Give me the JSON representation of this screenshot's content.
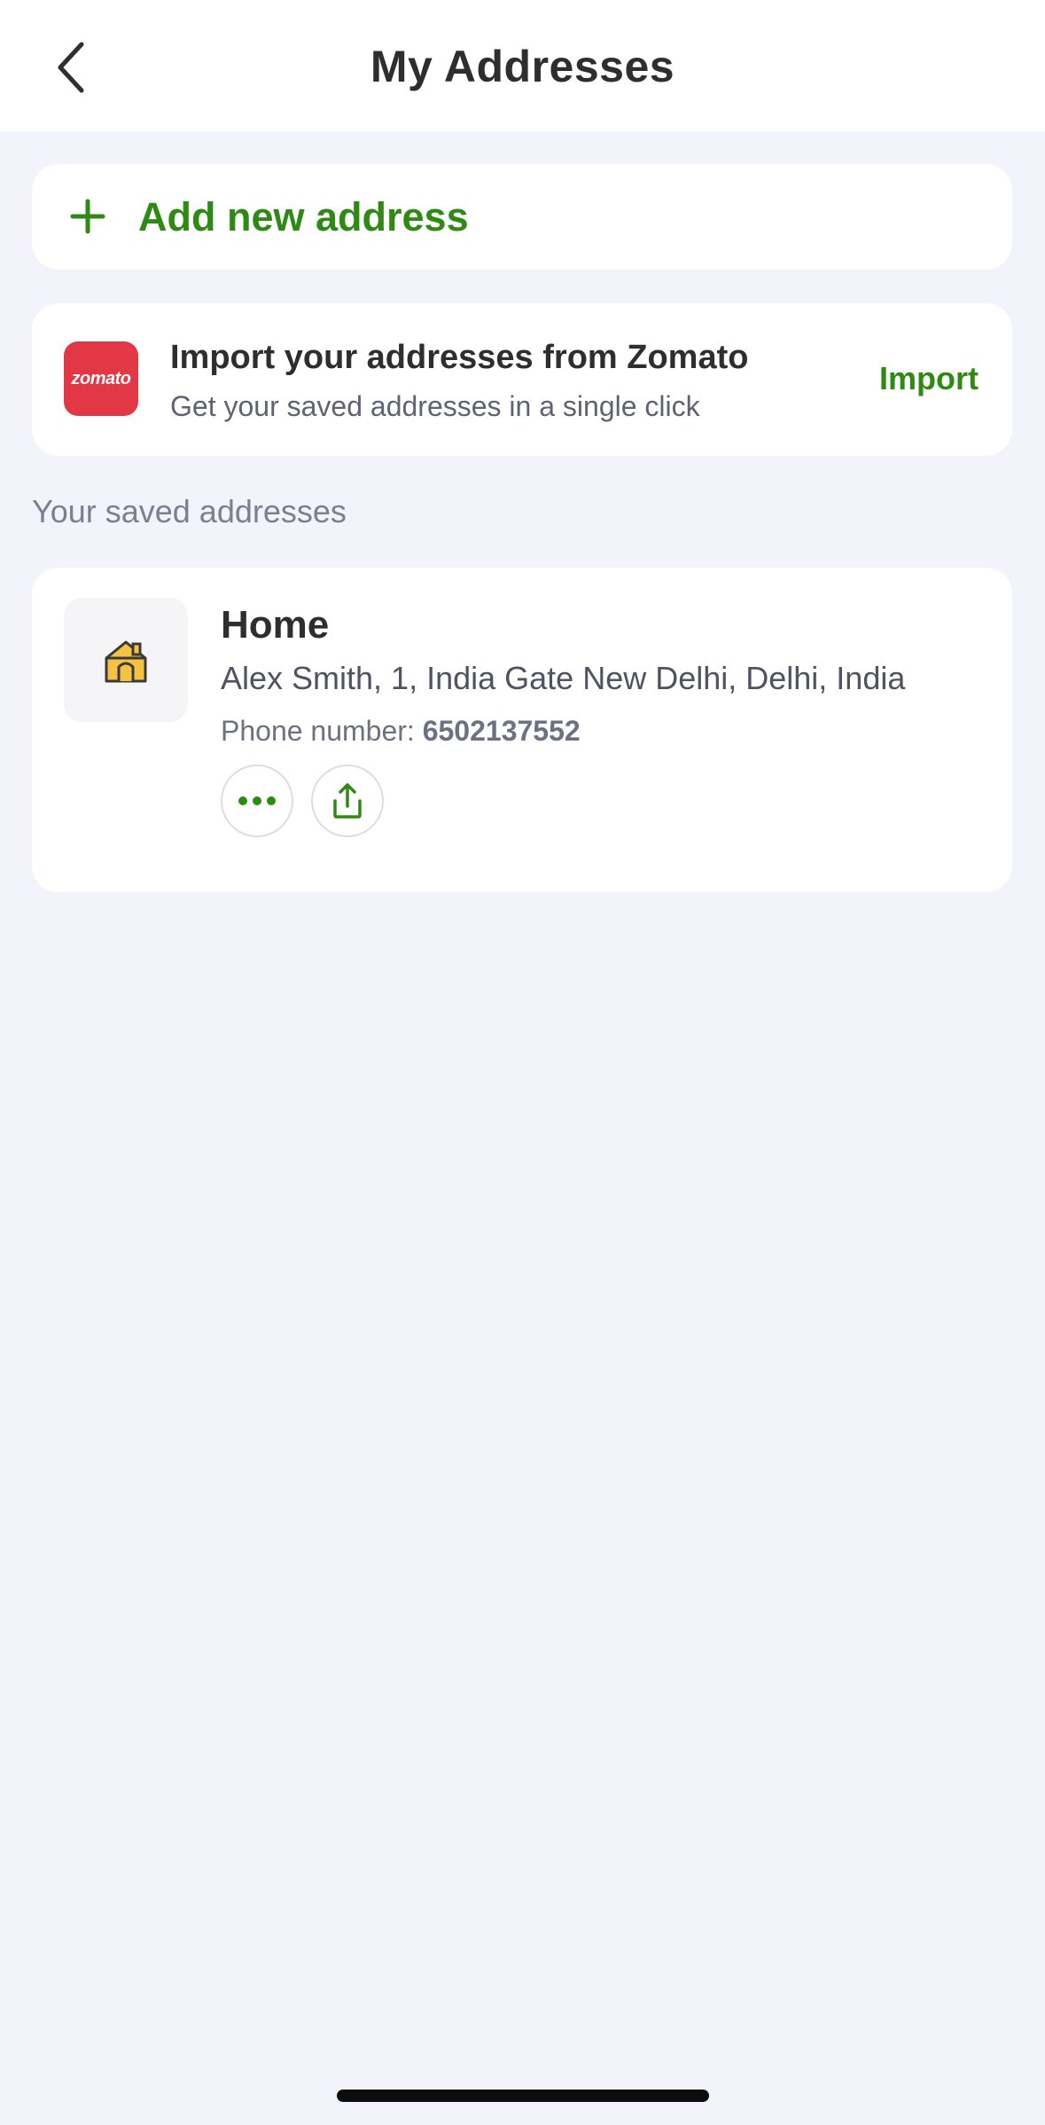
{
  "header": {
    "title": "My Addresses",
    "back_icon": "chevron-left-icon"
  },
  "add_address": {
    "icon": "plus-icon",
    "label": "Add new address"
  },
  "import_card": {
    "logo_text": "zomato",
    "logo_color": "#e23744",
    "title": "Import your addresses from Zomato",
    "subtitle": "Get your saved addresses in a single click",
    "action_label": "Import"
  },
  "saved_section": {
    "title": "Your saved addresses",
    "addresses": [
      {
        "icon": "home-icon",
        "label": "Home",
        "address": "Alex Smith, 1, India Gate New Delhi, Delhi, India",
        "phone_label": "Phone number: ",
        "phone_number": "6502137552",
        "actions": [
          "more-options-icon",
          "share-icon"
        ]
      }
    ]
  },
  "colors": {
    "accent_green": "#2f8a14",
    "background": "#f2f3fb",
    "card": "#ffffff"
  }
}
